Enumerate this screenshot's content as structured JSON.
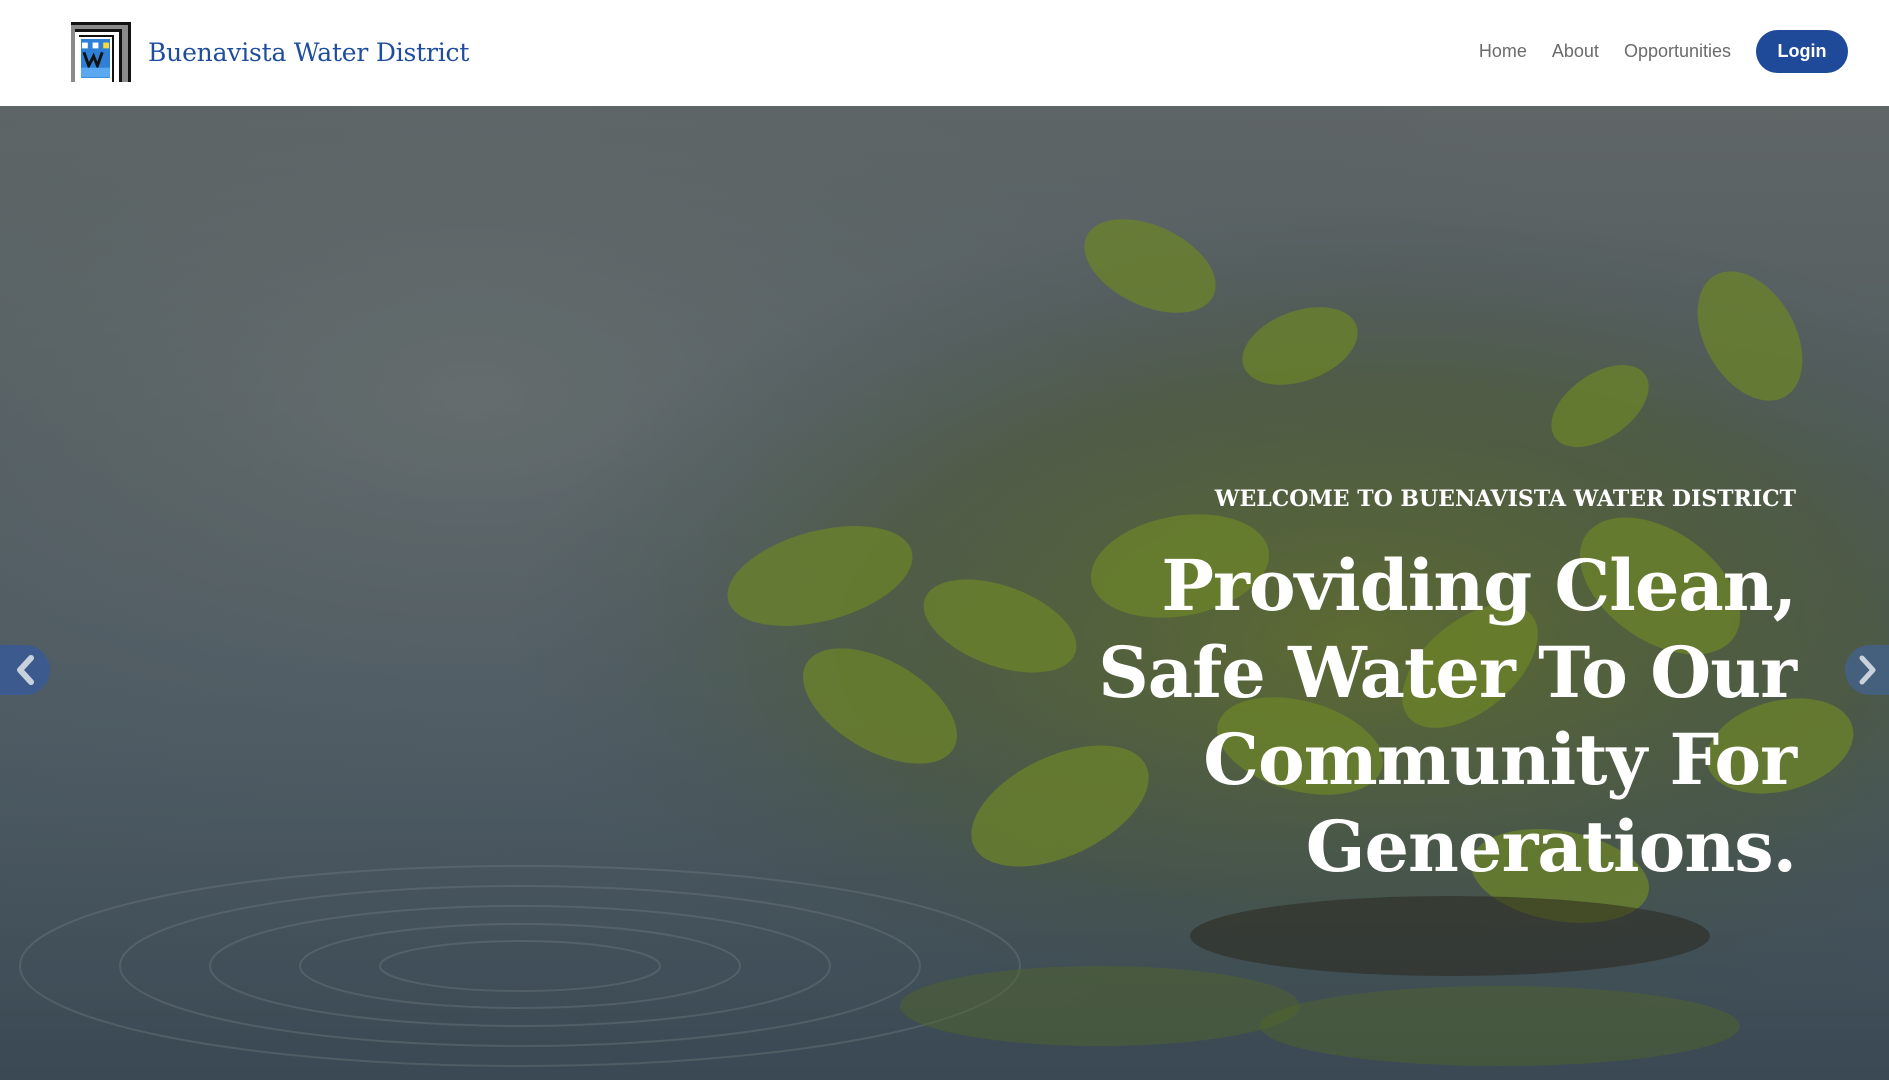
{
  "brand": {
    "name": "Buenavista Water District",
    "logo_icon": "bwd-logo-icon"
  },
  "nav": {
    "items": [
      {
        "label": "Home"
      },
      {
        "label": "About"
      },
      {
        "label": "Opportunities"
      }
    ],
    "login_label": "Login"
  },
  "hero": {
    "kicker": "WELCOME TO BUENAVISTA WATER DISTRICT",
    "title": "Providing Clean, Safe Water To Our Community For Generations.",
    "prev_icon": "chevron-left-icon",
    "next_icon": "chevron-right-icon"
  },
  "colors": {
    "brand_blue": "#1f4a99",
    "brand_text": "#1f4d9e",
    "nav_text": "#6b6b6b"
  }
}
